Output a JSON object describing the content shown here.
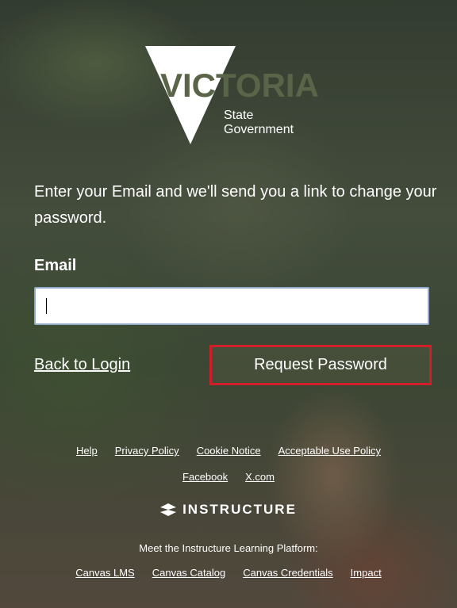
{
  "brand": {
    "logo_word": "VICTORIA",
    "logo_sub1": "State",
    "logo_sub2": "Government"
  },
  "form": {
    "intro": "Enter your Email and we'll send you a link to change your password.",
    "email_label": "Email",
    "email_value": "",
    "back_link": "Back to Login",
    "submit_label": "Request Password"
  },
  "footer": {
    "links_row1": [
      "Help",
      "Privacy Policy",
      "Cookie Notice",
      "Acceptable Use Policy"
    ],
    "links_row2": [
      "Facebook",
      "X.com"
    ],
    "instructure_label": "INSTRUCTURE",
    "meet_text": "Meet the Instructure Learning Platform:",
    "links_row3": [
      "Canvas LMS",
      "Canvas Catalog",
      "Canvas Credentials",
      "Impact"
    ]
  },
  "colors": {
    "highlight_border": "#d01f2a",
    "input_border": "#8fa9c7"
  },
  "icons": {
    "instructure_logo": "instructure-logo-icon"
  }
}
